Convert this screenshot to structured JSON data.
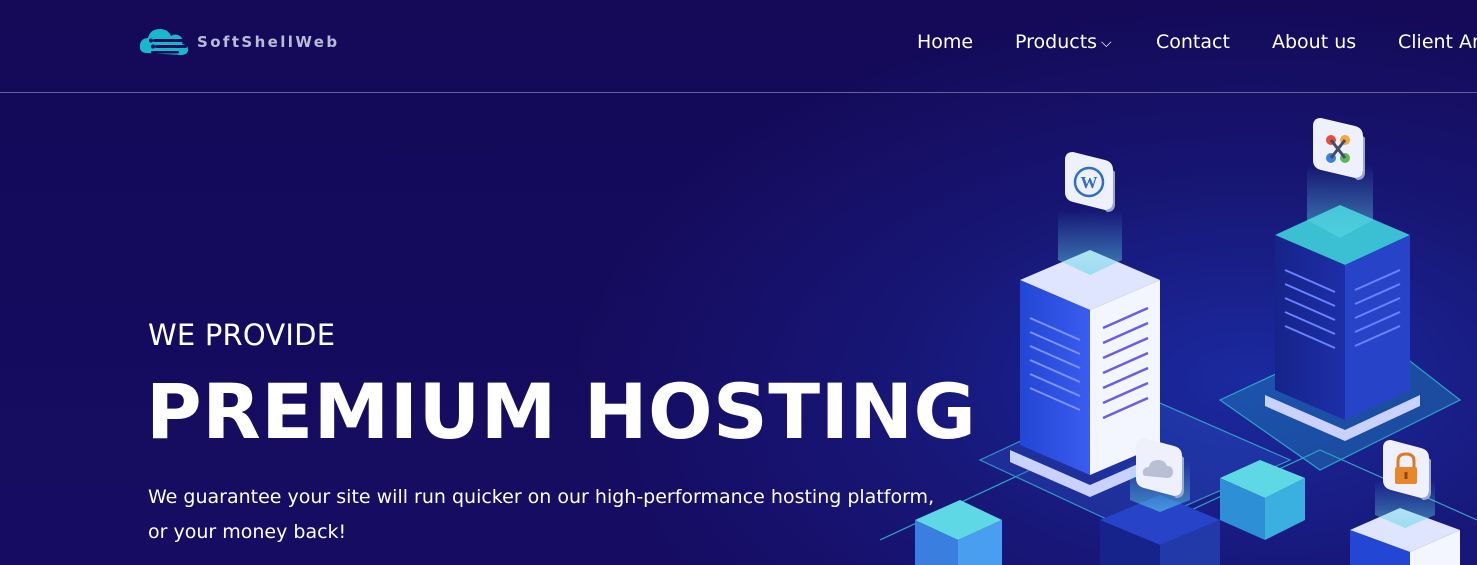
{
  "brand": {
    "name": "SoftShellWeb",
    "accent": "#17b4cc"
  },
  "nav": {
    "items": [
      {
        "label": "Home"
      },
      {
        "label": "Products",
        "has_dropdown": true,
        "dropdown_glyph": "⌵"
      },
      {
        "label": "Contact"
      },
      {
        "label": "About us"
      },
      {
        "label": "Client Ar"
      }
    ]
  },
  "hero": {
    "eyebrow": "WE PROVIDE",
    "headline": "PREMIUM HOSTING",
    "subtext": "We guarantee your site will run quicker on our high-performance hosting platform, or your money back!"
  },
  "illustration": {
    "icons": [
      "wordpress-icon",
      "joomla-icon",
      "cloud-icon",
      "lock-icon"
    ]
  },
  "colors": {
    "background": "#150c5c",
    "text": "#ffffff",
    "server_blue": "#2a48d8",
    "server_light": "#dfe4ff",
    "cyan": "#3fc9d6",
    "lock_orange": "#e8862b"
  }
}
